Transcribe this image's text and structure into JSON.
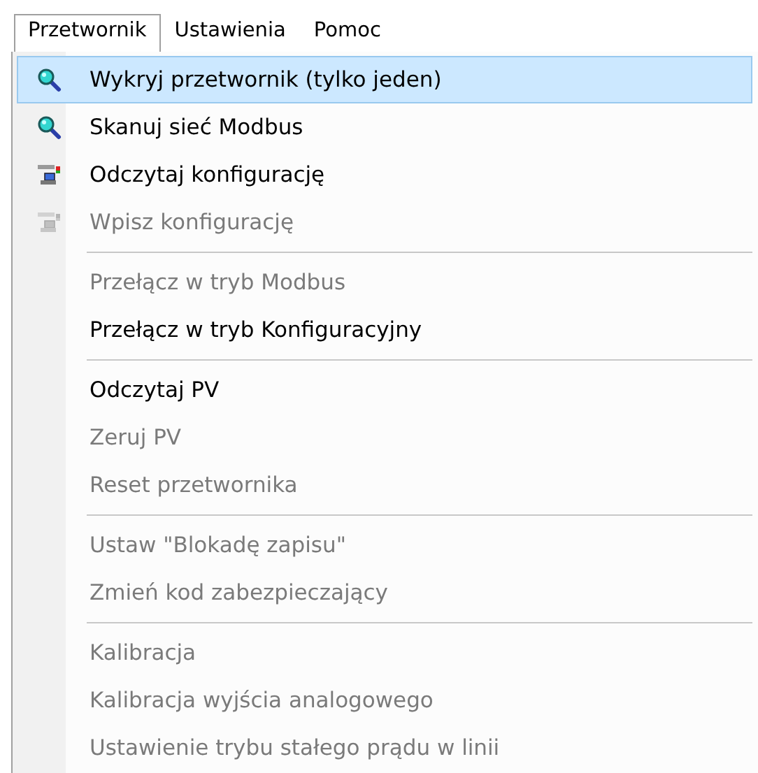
{
  "menubar": [
    {
      "label": "Przetwornik",
      "selected": true
    },
    {
      "label": "Ustawienia",
      "selected": false
    },
    {
      "label": "Pomoc",
      "selected": false
    }
  ],
  "menu": {
    "groups": [
      [
        {
          "label": "Wykryj przetwornik (tylko jeden)",
          "disabled": false,
          "selected": true
        },
        {
          "label": "Skanuj sieć Modbus",
          "disabled": false,
          "selected": false
        },
        {
          "label": "Odczytaj konfigurację",
          "disabled": false,
          "selected": false
        },
        {
          "label": "Wpisz konfigurację",
          "disabled": true,
          "selected": false
        }
      ],
      [
        {
          "label": "Przełącz w tryb Modbus",
          "disabled": true,
          "selected": false
        },
        {
          "label": "Przełącz w tryb Konfiguracyjny",
          "disabled": false,
          "selected": false
        }
      ],
      [
        {
          "label": "Odczytaj PV",
          "disabled": false,
          "selected": false
        },
        {
          "label": "Zeruj PV",
          "disabled": true,
          "selected": false
        },
        {
          "label": "Reset przetwornika",
          "disabled": true,
          "selected": false
        }
      ],
      [
        {
          "label": "Ustaw \"Blokadę zapisu\"",
          "disabled": true,
          "selected": false
        },
        {
          "label": "Zmień kod zabezpieczający",
          "disabled": true,
          "selected": false
        }
      ],
      [
        {
          "label": "Kalibracja",
          "disabled": true,
          "selected": false
        },
        {
          "label": "Kalibracja wyjścia analogowego",
          "disabled": true,
          "selected": false
        },
        {
          "label": "Ustawienie trybu stałego prądu w linii",
          "disabled": true,
          "selected": false
        }
      ]
    ]
  }
}
